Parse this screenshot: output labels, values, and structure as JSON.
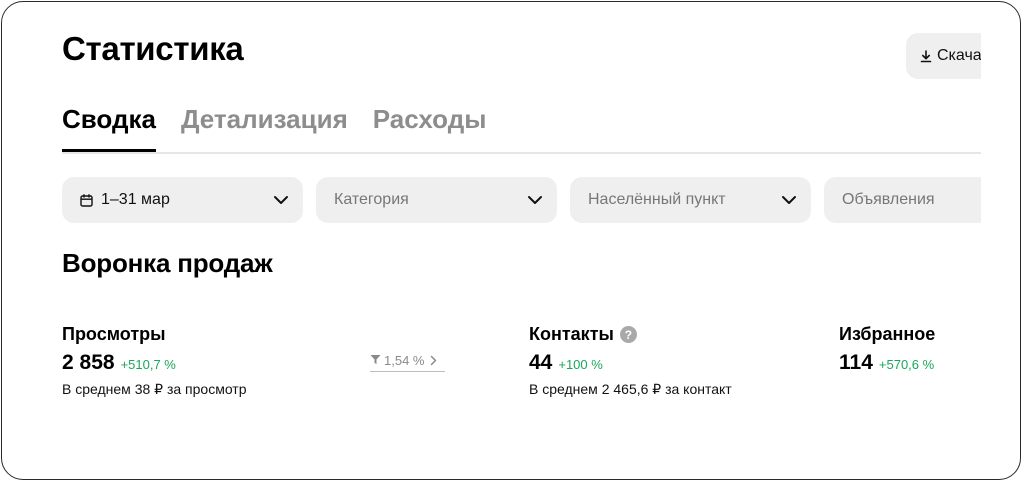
{
  "page": {
    "title": "Статистика",
    "download_label": "Скачать"
  },
  "tabs": [
    {
      "label": "Сводка",
      "active": true
    },
    {
      "label": "Детализация",
      "active": false
    },
    {
      "label": "Расходы",
      "active": false
    }
  ],
  "filters": {
    "date": "1–31 мар",
    "category": "Категория",
    "locality": "Населённый пункт",
    "ads": "Объявления"
  },
  "funnel": {
    "title": "Воронка продаж",
    "views": {
      "label": "Просмотры",
      "value": "2 858",
      "change": "+510,7 %",
      "avg": "В среднем 38 ₽ за просмотр"
    },
    "conversion": "1,54 %",
    "contacts": {
      "label": "Контакты",
      "value": "44",
      "change": "+100 %",
      "avg": "В среднем 2 465,6 ₽ за контакт"
    },
    "favorites": {
      "label": "Избранное",
      "value": "114",
      "change": "+570,6 %"
    }
  },
  "icons": {
    "download": "download-icon",
    "calendar": "calendar-icon",
    "chevron": "chevron-down-icon",
    "help": "question-icon",
    "funnel": "funnel-icon",
    "arrow": "chevron-right-icon"
  },
  "colors": {
    "positive_change": "#19a75b",
    "filter_bg": "#efefef",
    "inactive_tab": "#8d8d8d"
  }
}
